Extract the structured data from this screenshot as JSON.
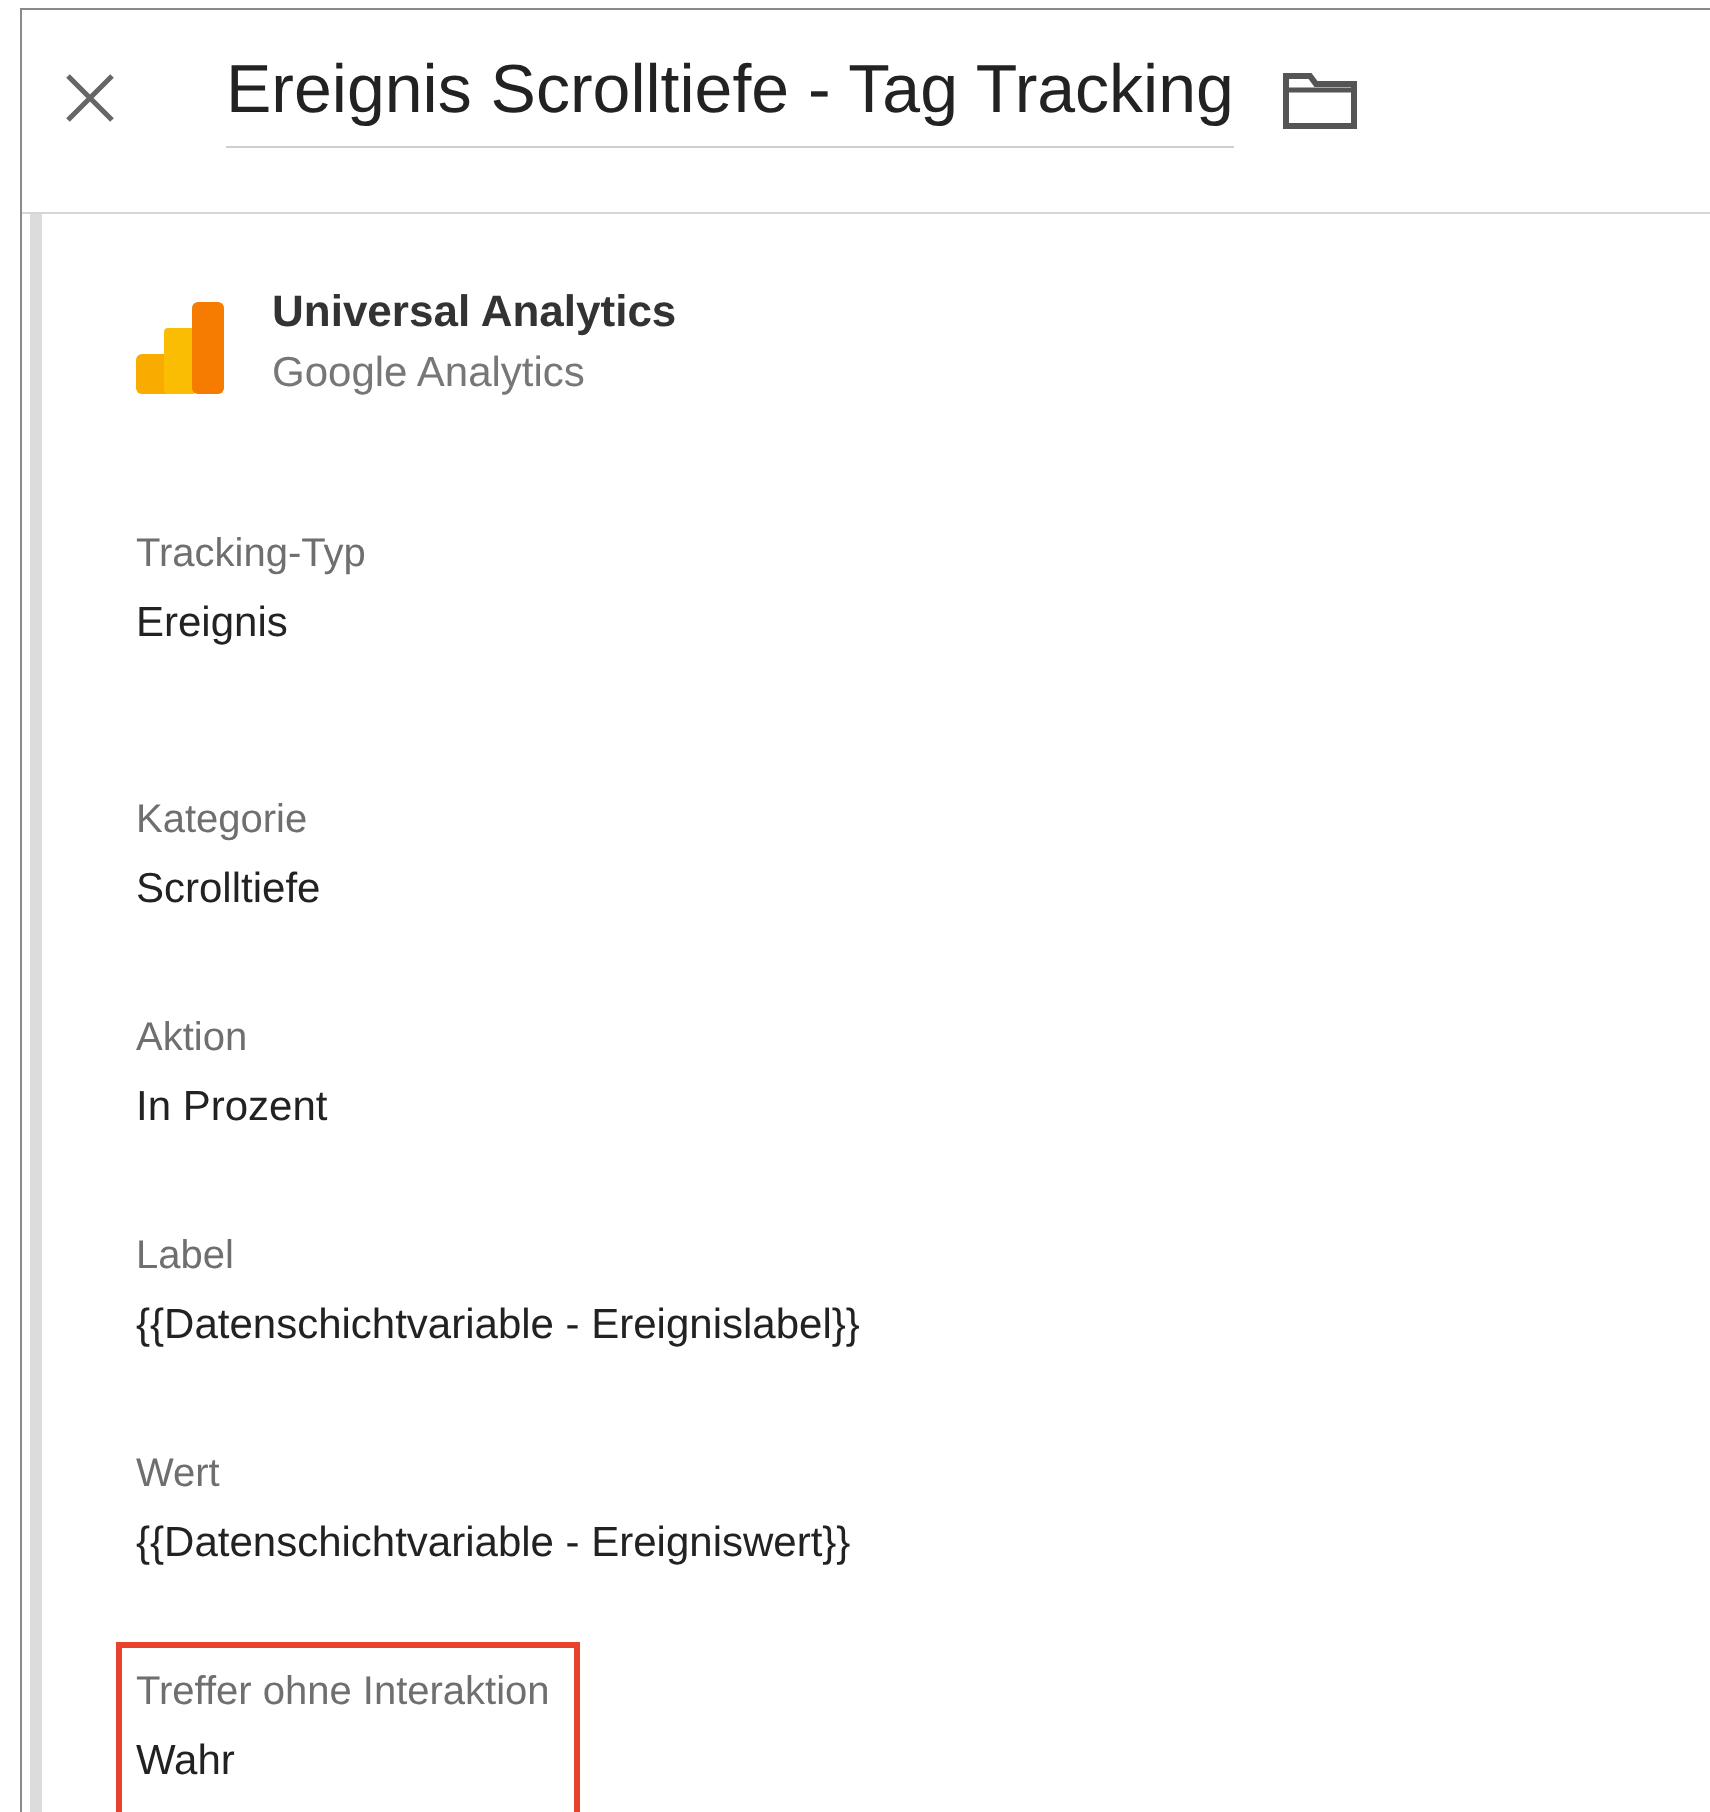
{
  "header": {
    "title": "Ereignis Scrolltiefe - Tag Tracking"
  },
  "tag_type": {
    "name": "Universal Analytics",
    "vendor": "Google Analytics"
  },
  "fields": [
    {
      "label": "Tracking-Typ",
      "value": "Ereignis",
      "highlighted": false
    },
    {
      "label": "Kategorie",
      "value": "Scrolltiefe",
      "highlighted": false
    },
    {
      "label": "Aktion",
      "value": "In Prozent",
      "highlighted": false
    },
    {
      "label": "Label",
      "value": "{{Datenschichtvariable - Ereignislabel}}",
      "highlighted": false
    },
    {
      "label": "Wert",
      "value": "{{Datenschichtvariable - Ereigniswert}}",
      "highlighted": false
    },
    {
      "label": "Treffer ohne Interaktion",
      "value": "Wahr",
      "highlighted": true
    }
  ]
}
